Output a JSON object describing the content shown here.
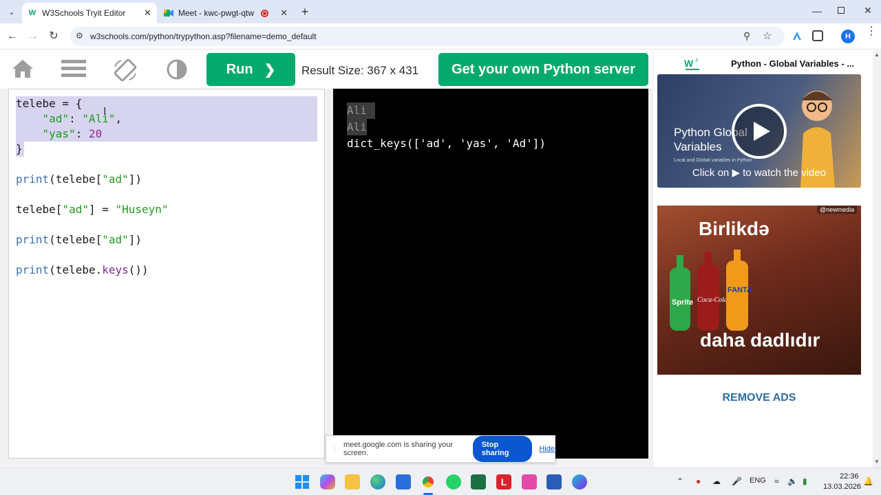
{
  "browser": {
    "tabs": [
      {
        "title": "W3Schools Tryit Editor",
        "active": true
      },
      {
        "title": "Meet - kwc-pwgt-qtw",
        "active": false
      }
    ],
    "url": "w3schools.com/python/trypython.asp?filename=demo_default",
    "profile_initial": "H"
  },
  "toolbar": {
    "run_label": "Run",
    "result_size": "Result Size: 367 x 431",
    "server_button": "Get your own Python server"
  },
  "editor": {
    "lines": [
      "telebe = {",
      "    \"ad\": \"Ali\",",
      "    \"yas\": 20",
      "}",
      "",
      "print(telebe[\"ad\"])",
      "",
      "telebe[\"ad\"] = \"Huseyn\"",
      "",
      "print(telebe[\"ad\"])",
      "",
      "print(telebe.keys())"
    ]
  },
  "result": {
    "output_lines": [
      "Ali",
      "Ali",
      "dict_keys(['ad', 'yas', 'Ad'])"
    ]
  },
  "sidebar": {
    "video_title": "Python - Global Variables - ...",
    "video_card_title": "Python Global Variables",
    "video_card_subtitle": "Local and Global variables in Python",
    "watch_text": "Click on ▶ to watch the video",
    "ad_badge": "@newmedia",
    "ad_headline": "Birlikdə",
    "ad_tagline": "daha dadlıdır",
    "remove_ads": "REMOVE ADS"
  },
  "share_banner": {
    "message": "meet.google.com is sharing your screen.",
    "stop_label": "Stop sharing",
    "hide_label": "Hide"
  },
  "taskbar": {
    "language": "ENG",
    "time": "22:36",
    "date": "13.03.2026"
  }
}
